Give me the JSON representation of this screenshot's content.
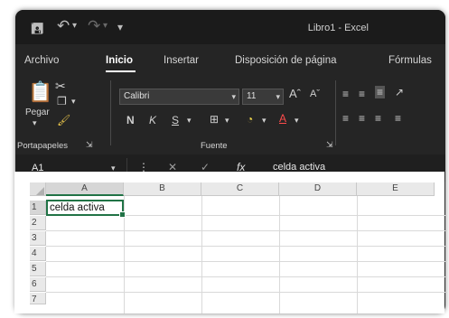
{
  "window": {
    "title": "Libro1 - Excel"
  },
  "tabs": [
    "Archivo",
    "Inicio",
    "Insertar",
    "Disposición de página",
    "Fórmulas"
  ],
  "ribbon": {
    "paste_label": "Pegar",
    "font_name": "Calibri",
    "font_size": "11",
    "bold": "N",
    "italic": "K",
    "underline": "S",
    "groups": {
      "clipboard": "Portapapeles",
      "font": "Fuente"
    }
  },
  "formula_bar": {
    "name_box": "A1",
    "fx": "fx",
    "content": "celda activa"
  },
  "sheet": {
    "columns": [
      "A",
      "B",
      "C",
      "D",
      "E"
    ],
    "rows": [
      "1",
      "2",
      "3",
      "4",
      "5",
      "6",
      "7"
    ],
    "cells": {
      "A1": "celda activa"
    }
  }
}
